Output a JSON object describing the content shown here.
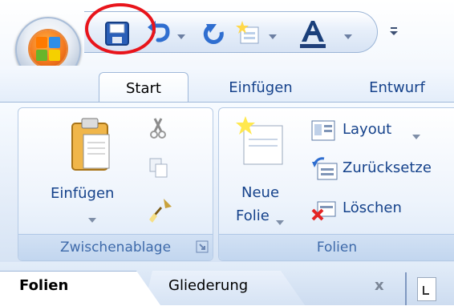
{
  "tabs": [
    "Start",
    "Einfügen",
    "Entwurf"
  ],
  "groups": {
    "clipboard": {
      "label": "Zwischenablage",
      "paste_label": "Einfügen"
    },
    "slides": {
      "label": "Folien",
      "new_slide_line1": "Neue",
      "new_slide_line2": "Folie",
      "layout_label": "Layout",
      "reset_label": "Zurücksetze",
      "delete_label": "Löschen"
    }
  },
  "pane_tabs": [
    "Folien",
    "Gliederung"
  ],
  "pane_close": "x",
  "colors": {
    "annotation": "#e8141b",
    "text": "#15428b",
    "office_orange": "#f47b20"
  },
  "icons": [
    "save-icon",
    "undo-icon",
    "redo-icon",
    "new-slide-icon",
    "font-color-icon",
    "cut-icon",
    "copy-icon",
    "format-painter-icon",
    "paste-icon",
    "layout-icon",
    "reset-icon",
    "delete-icon",
    "dialog-launcher-icon"
  ]
}
